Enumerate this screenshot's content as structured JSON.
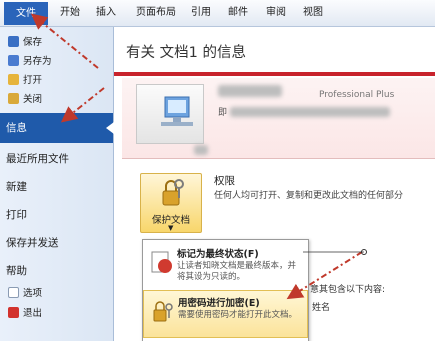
{
  "ribbon": {
    "tabs": [
      "文件",
      "开始",
      "插入",
      "页面布局",
      "引用",
      "邮件",
      "审阅",
      "视图"
    ]
  },
  "sidebar": {
    "small_items": [
      {
        "label": "保存",
        "icon": "save-icon"
      },
      {
        "label": "另存为",
        "icon": "save-as-icon"
      },
      {
        "label": "打开",
        "icon": "open-folder-icon"
      },
      {
        "label": "关闭",
        "icon": "close-folder-icon"
      }
    ],
    "active": "信息",
    "items": [
      "最近所用文件",
      "新建",
      "打印",
      "保存并发送",
      "帮助"
    ],
    "bottom_items": [
      {
        "label": "选项",
        "icon": "options-icon"
      },
      {
        "label": "退出",
        "icon": "exit-icon"
      }
    ]
  },
  "main": {
    "title": "有关 文档1 的信息",
    "doc_info_fragment": "Professional Plus",
    "doc_info_char": "即",
    "permissions": {
      "button_label": "保护文档",
      "title": "权限",
      "desc": "任何人均可打开、复制和更改此文档的任何部分"
    },
    "protect_menu": [
      {
        "title": "标记为最终状态(F)",
        "desc": "让读者知晓文档是最终版本，并将其设为只读的。"
      },
      {
        "title": "用密码进行加密(E)",
        "desc": "需要使用密码才能打开此文档。"
      }
    ],
    "prepare": {
      "line1": "意其包含以下内容:",
      "line2": "姓名"
    }
  },
  "colors": {
    "file_tab": "#2a64ba",
    "active_item": "#1f5aaa",
    "info_band": "#c8232c",
    "annotation_arrow": "#c0392b"
  }
}
